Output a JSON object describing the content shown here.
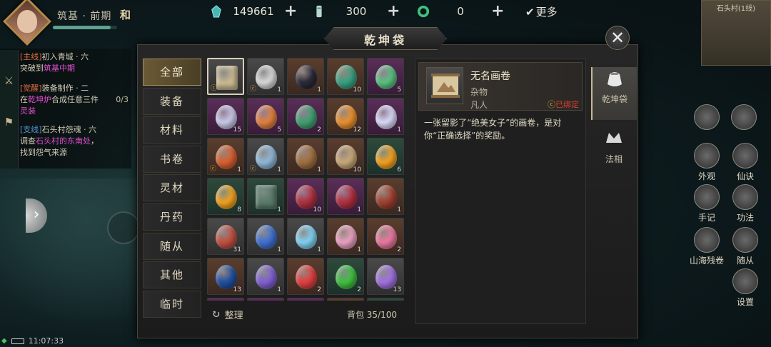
{
  "hud": {
    "realm": "筑基 · 前期",
    "realm_flag": "和",
    "realm_progress": 0.9,
    "currencies": [
      {
        "icon": "jade-crystal-icon",
        "value": "149661"
      },
      {
        "icon": "scroll-token-icon",
        "value": "300"
      },
      {
        "icon": "green-ring-icon",
        "value": "0"
      }
    ],
    "more_label": "更多",
    "time": "11:07:33",
    "minimap_title": "石头村(1线)"
  },
  "quests": [
    {
      "tag": "[主线]",
      "title": "初入青城 · 六",
      "line2_pre": "突破到",
      "line2_hl": "筑基中期",
      "progress": ""
    },
    {
      "tag": "[觉醒]",
      "title": "装备制作 · 二",
      "line2_pre": "在",
      "line2_hl": "乾坤炉",
      "line2_post": "合成任意三件",
      "line3": "灵装",
      "progress": "0/3"
    },
    {
      "tag": "[支线]",
      "title": "石头村怨魂 · 六",
      "line2_pre": "调查",
      "line2_hl": "石头村的东南处",
      "line2_post": "，",
      "line3": "找到怨气来源",
      "progress": ""
    }
  ],
  "panel": {
    "title": "乾坤袋",
    "categories": [
      "全部",
      "装备",
      "材料",
      "书卷",
      "灵材",
      "丹药",
      "随从",
      "其他",
      "临时"
    ],
    "sort_label": "整理",
    "capacity_label": "背包 35/100"
  },
  "items": [
    {
      "icon": "scroll-painting-icon",
      "rarity": "white",
      "count": "",
      "bound": true,
      "selected": true,
      "color": "#c8b890"
    },
    {
      "icon": "white-stone-icon",
      "rarity": "white",
      "count": "1",
      "bound": true,
      "color": "#d8d8d8"
    },
    {
      "icon": "black-pebble-icon",
      "rarity": "brown",
      "count": "1",
      "bound": false,
      "color": "#2a2a3a"
    },
    {
      "icon": "green-crystal-icon",
      "rarity": "brown",
      "count": "10",
      "bound": false,
      "color": "#3aa080"
    },
    {
      "icon": "jade-stone-icon",
      "rarity": "purple",
      "count": "5",
      "bound": false,
      "color": "#5ac080"
    },
    {
      "icon": "pearl-stone-icon",
      "rarity": "purple",
      "count": "15",
      "bound": false,
      "color": "#c8c8e8"
    },
    {
      "icon": "amber-stone-icon",
      "rarity": "purple",
      "count": "5",
      "bound": false,
      "color": "#e08040"
    },
    {
      "icon": "emerald-stone-icon",
      "rarity": "purple",
      "count": "2",
      "bound": false,
      "color": "#40a070"
    },
    {
      "icon": "fire-crystal-icon",
      "rarity": "brown",
      "count": "12",
      "bound": false,
      "color": "#e89030"
    },
    {
      "icon": "lotus-flower-icon",
      "rarity": "purple",
      "count": "1",
      "bound": false,
      "color": "#d8d8f8"
    },
    {
      "icon": "fire-orb-icon",
      "rarity": "brown",
      "count": "1",
      "bound": true,
      "color": "#d86030"
    },
    {
      "icon": "spirit-ring-icon",
      "rarity": "white",
      "count": "1",
      "bound": true,
      "color": "#90b8d8"
    },
    {
      "icon": "earth-pile-icon",
      "rarity": "brown",
      "count": "1",
      "bound": false,
      "color": "#a07040"
    },
    {
      "icon": "wooden-staff-icon",
      "rarity": "brown",
      "count": "10",
      "bound": false,
      "color": "#c8a878"
    },
    {
      "icon": "gold-egg-icon",
      "rarity": "green",
      "count": "6",
      "bound": false,
      "color": "#f0a020"
    },
    {
      "icon": "gold-egg-icon",
      "rarity": "green",
      "count": "8",
      "bound": false,
      "color": "#f0a020"
    },
    {
      "icon": "manual-book-icon",
      "rarity": "green",
      "count": "1",
      "bound": false,
      "color": "#5a7a6a"
    },
    {
      "icon": "red-berries-icon",
      "rarity": "purple",
      "count": "10",
      "bound": false,
      "color": "#b03040"
    },
    {
      "icon": "red-berries-icon",
      "rarity": "purple",
      "count": "1",
      "bound": false,
      "color": "#b03040"
    },
    {
      "icon": "red-seed-icon",
      "rarity": "brown",
      "count": "1",
      "bound": false,
      "color": "#a04030"
    },
    {
      "icon": "red-sand-icon",
      "rarity": "white",
      "count": "31",
      "bound": false,
      "color": "#c05040"
    },
    {
      "icon": "blue-vortex-icon",
      "rarity": "white",
      "count": "1",
      "bound": false,
      "color": "#4070d0"
    },
    {
      "icon": "ice-vortex-icon",
      "rarity": "white",
      "count": "1",
      "bound": false,
      "color": "#80d0f0"
    },
    {
      "icon": "pink-blossom-icon",
      "rarity": "brown",
      "count": "1",
      "bound": false,
      "color": "#e8a0c0"
    },
    {
      "icon": "pink-lily-icon",
      "rarity": "brown",
      "count": "2",
      "bound": false,
      "color": "#e878a0"
    },
    {
      "icon": "night-orb-icon",
      "rarity": "brown",
      "count": "13",
      "bound": false,
      "color": "#2050a0"
    },
    {
      "icon": "violet-spirit-icon",
      "rarity": "white",
      "count": "1",
      "bound": false,
      "color": "#8060d0"
    },
    {
      "icon": "red-lily-icon",
      "rarity": "brown",
      "count": "2",
      "bound": false,
      "color": "#e04040"
    },
    {
      "icon": "green-swirl-icon",
      "rarity": "green",
      "count": "2",
      "bound": false,
      "color": "#40c040"
    },
    {
      "icon": "violet-lily-icon",
      "rarity": "white",
      "count": "13",
      "bound": false,
      "color": "#a070e0"
    },
    {
      "icon": "partial-item-icon",
      "rarity": "purple",
      "count": "",
      "bound": false,
      "color": "#5a3a5a"
    },
    {
      "icon": "partial-item-icon",
      "rarity": "purple",
      "count": "",
      "bound": false,
      "color": "#5a3a5a"
    },
    {
      "icon": "partial-item-icon",
      "rarity": "purple",
      "count": "",
      "bound": false,
      "color": "#5a3a5a"
    },
    {
      "icon": "partial-item-icon",
      "rarity": "brown",
      "count": "",
      "bound": false,
      "color": "#5a3e2e"
    },
    {
      "icon": "partial-item-icon",
      "rarity": "green",
      "count": "",
      "bound": false,
      "color": "#2e4a3c"
    }
  ],
  "detail": {
    "name": "无名画卷",
    "type": "杂物",
    "grade": "凡人",
    "bound_label": "已绑定",
    "description": "一张留影了“绝美女子”的画卷，是对你“正确选择”的奖励。"
  },
  "side_tabs": [
    {
      "label": "乾坤袋",
      "icon": "pouch-icon"
    },
    {
      "label": "法相",
      "icon": "dharma-crown-icon"
    }
  ],
  "right_menu": [
    {
      "label": "外观",
      "icon": "appearance-icon"
    },
    {
      "label": "仙诀",
      "icon": "immortal-scroll-icon"
    },
    {
      "label": "手记",
      "icon": "notebook-icon"
    },
    {
      "label": "功法",
      "icon": "skill-icon"
    },
    {
      "label": "山海残卷",
      "icon": "mountain-sea-icon"
    },
    {
      "label": "随从",
      "icon": "follower-icon"
    },
    {
      "label": "设置",
      "icon": "gear-icon"
    }
  ],
  "colors": {
    "accent": "#a89060",
    "bound_red": "#d84030",
    "quest_highlight": "#e050d0"
  }
}
